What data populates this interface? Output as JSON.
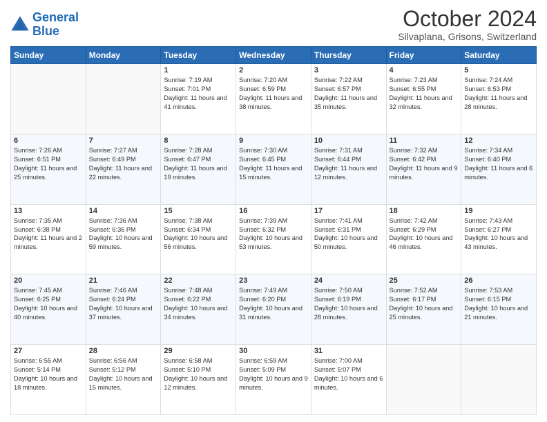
{
  "header": {
    "logo_line1": "General",
    "logo_line2": "Blue",
    "month": "October 2024",
    "location": "Silvaplana, Grisons, Switzerland"
  },
  "days_of_week": [
    "Sunday",
    "Monday",
    "Tuesday",
    "Wednesday",
    "Thursday",
    "Friday",
    "Saturday"
  ],
  "weeks": [
    [
      {
        "day": "",
        "info": ""
      },
      {
        "day": "",
        "info": ""
      },
      {
        "day": "1",
        "info": "Sunrise: 7:19 AM\nSunset: 7:01 PM\nDaylight: 11 hours and 41 minutes."
      },
      {
        "day": "2",
        "info": "Sunrise: 7:20 AM\nSunset: 6:59 PM\nDaylight: 11 hours and 38 minutes."
      },
      {
        "day": "3",
        "info": "Sunrise: 7:22 AM\nSunset: 6:57 PM\nDaylight: 11 hours and 35 minutes."
      },
      {
        "day": "4",
        "info": "Sunrise: 7:23 AM\nSunset: 6:55 PM\nDaylight: 11 hours and 32 minutes."
      },
      {
        "day": "5",
        "info": "Sunrise: 7:24 AM\nSunset: 6:53 PM\nDaylight: 11 hours and 28 minutes."
      }
    ],
    [
      {
        "day": "6",
        "info": "Sunrise: 7:26 AM\nSunset: 6:51 PM\nDaylight: 11 hours and 25 minutes."
      },
      {
        "day": "7",
        "info": "Sunrise: 7:27 AM\nSunset: 6:49 PM\nDaylight: 11 hours and 22 minutes."
      },
      {
        "day": "8",
        "info": "Sunrise: 7:28 AM\nSunset: 6:47 PM\nDaylight: 11 hours and 19 minutes."
      },
      {
        "day": "9",
        "info": "Sunrise: 7:30 AM\nSunset: 6:45 PM\nDaylight: 11 hours and 15 minutes."
      },
      {
        "day": "10",
        "info": "Sunrise: 7:31 AM\nSunset: 6:44 PM\nDaylight: 11 hours and 12 minutes."
      },
      {
        "day": "11",
        "info": "Sunrise: 7:32 AM\nSunset: 6:42 PM\nDaylight: 11 hours and 9 minutes."
      },
      {
        "day": "12",
        "info": "Sunrise: 7:34 AM\nSunset: 6:40 PM\nDaylight: 11 hours and 6 minutes."
      }
    ],
    [
      {
        "day": "13",
        "info": "Sunrise: 7:35 AM\nSunset: 6:38 PM\nDaylight: 11 hours and 2 minutes."
      },
      {
        "day": "14",
        "info": "Sunrise: 7:36 AM\nSunset: 6:36 PM\nDaylight: 10 hours and 59 minutes."
      },
      {
        "day": "15",
        "info": "Sunrise: 7:38 AM\nSunset: 6:34 PM\nDaylight: 10 hours and 56 minutes."
      },
      {
        "day": "16",
        "info": "Sunrise: 7:39 AM\nSunset: 6:32 PM\nDaylight: 10 hours and 53 minutes."
      },
      {
        "day": "17",
        "info": "Sunrise: 7:41 AM\nSunset: 6:31 PM\nDaylight: 10 hours and 50 minutes."
      },
      {
        "day": "18",
        "info": "Sunrise: 7:42 AM\nSunset: 6:29 PM\nDaylight: 10 hours and 46 minutes."
      },
      {
        "day": "19",
        "info": "Sunrise: 7:43 AM\nSunset: 6:27 PM\nDaylight: 10 hours and 43 minutes."
      }
    ],
    [
      {
        "day": "20",
        "info": "Sunrise: 7:45 AM\nSunset: 6:25 PM\nDaylight: 10 hours and 40 minutes."
      },
      {
        "day": "21",
        "info": "Sunrise: 7:46 AM\nSunset: 6:24 PM\nDaylight: 10 hours and 37 minutes."
      },
      {
        "day": "22",
        "info": "Sunrise: 7:48 AM\nSunset: 6:22 PM\nDaylight: 10 hours and 34 minutes."
      },
      {
        "day": "23",
        "info": "Sunrise: 7:49 AM\nSunset: 6:20 PM\nDaylight: 10 hours and 31 minutes."
      },
      {
        "day": "24",
        "info": "Sunrise: 7:50 AM\nSunset: 6:19 PM\nDaylight: 10 hours and 28 minutes."
      },
      {
        "day": "25",
        "info": "Sunrise: 7:52 AM\nSunset: 6:17 PM\nDaylight: 10 hours and 25 minutes."
      },
      {
        "day": "26",
        "info": "Sunrise: 7:53 AM\nSunset: 6:15 PM\nDaylight: 10 hours and 21 minutes."
      }
    ],
    [
      {
        "day": "27",
        "info": "Sunrise: 6:55 AM\nSunset: 5:14 PM\nDaylight: 10 hours and 18 minutes."
      },
      {
        "day": "28",
        "info": "Sunrise: 6:56 AM\nSunset: 5:12 PM\nDaylight: 10 hours and 15 minutes."
      },
      {
        "day": "29",
        "info": "Sunrise: 6:58 AM\nSunset: 5:10 PM\nDaylight: 10 hours and 12 minutes."
      },
      {
        "day": "30",
        "info": "Sunrise: 6:59 AM\nSunset: 5:09 PM\nDaylight: 10 hours and 9 minutes."
      },
      {
        "day": "31",
        "info": "Sunrise: 7:00 AM\nSunset: 5:07 PM\nDaylight: 10 hours and 6 minutes."
      },
      {
        "day": "",
        "info": ""
      },
      {
        "day": "",
        "info": ""
      }
    ]
  ]
}
